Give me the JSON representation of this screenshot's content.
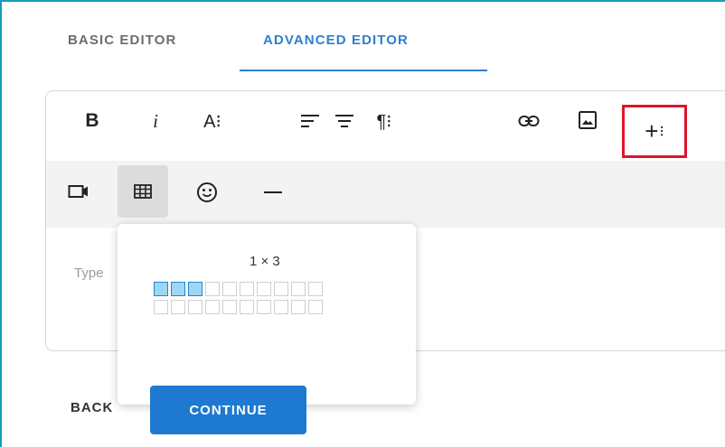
{
  "tabs": [
    {
      "label": "BASIC EDITOR",
      "active": false
    },
    {
      "label": "ADVANCED EDITOR",
      "active": true
    }
  ],
  "colors": {
    "accent": "#2f7fcf",
    "highlight_border": "#e0142a",
    "primary_button": "#1e79d1",
    "selected_cell": "#9fd6f4"
  },
  "toolbar": {
    "bold": "B",
    "italic": "i",
    "font_size": "A⁝",
    "paragraph": "¶⁝",
    "insert_more": "+",
    "insert_more_suffix": "⁝",
    "icons": [
      "align-left-icon",
      "align-center-icon",
      "link-icon",
      "image-icon",
      "video-icon",
      "table-icon",
      "emoji-icon",
      "horizontal-line-icon"
    ]
  },
  "editor": {
    "placeholder": "Type"
  },
  "table_popup": {
    "label": "1 × 3",
    "rows": 2,
    "columns": 10,
    "selected_rows": 1,
    "selected_columns": 3
  },
  "footer": {
    "back_label": "BACK",
    "continue_label": "CONTINUE"
  }
}
